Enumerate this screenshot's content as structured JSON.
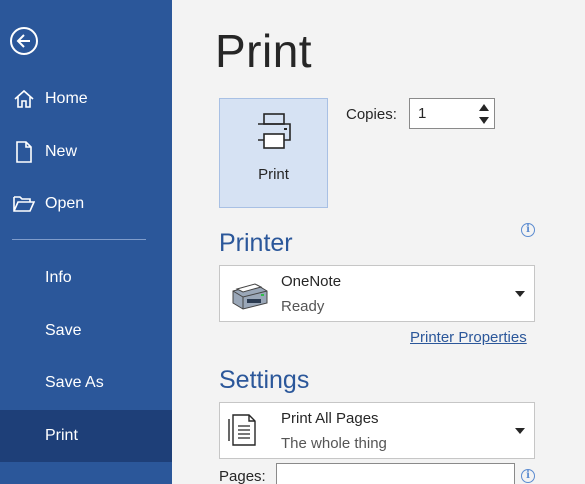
{
  "sidebar": {
    "back_icon": "back-arrow-circle-icon",
    "items": [
      {
        "label": "Home",
        "icon": "home-icon"
      },
      {
        "label": "New",
        "icon": "new-document-icon"
      },
      {
        "label": "Open",
        "icon": "open-folder-icon"
      },
      {
        "label": "Info"
      },
      {
        "label": "Save"
      },
      {
        "label": "Save As"
      },
      {
        "label": "Print",
        "selected": true
      }
    ]
  },
  "main": {
    "title": "Print",
    "print_button": {
      "label": "Print",
      "icon": "printer-icon"
    },
    "copies": {
      "label": "Copies:",
      "value": "1"
    },
    "printer": {
      "heading": "Printer",
      "name": "OneNote",
      "status": "Ready",
      "icon": "printer-device-icon",
      "properties_link": "Printer Properties"
    },
    "settings": {
      "heading": "Settings",
      "pages_mode": "Print All Pages",
      "pages_mode_description": "The whole thing",
      "icon": "pages-document-icon",
      "pages_label": "Pages:",
      "pages_value": ""
    }
  },
  "colors": {
    "sidebar_bg": "#2b579a",
    "sidebar_selected": "#1e3f78",
    "accent": "#2b579a",
    "print_button_bg": "#d6e2f3"
  }
}
